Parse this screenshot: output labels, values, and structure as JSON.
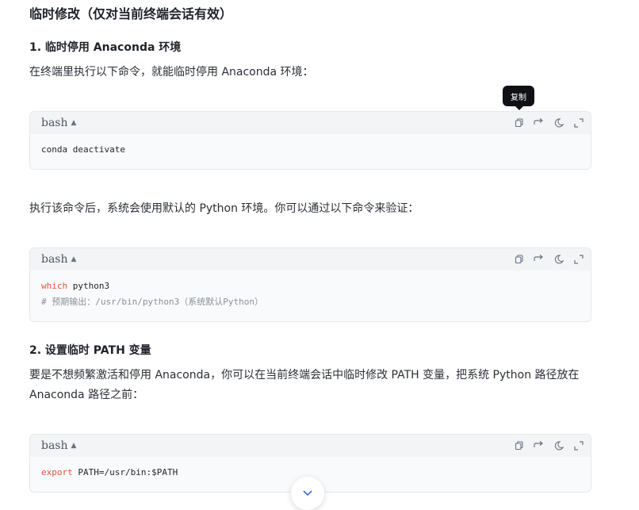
{
  "heading": "临时修改（仅对当前终端会话有效）",
  "section1": {
    "title": "1. 临时停用 Anaconda 环境",
    "para": "在终端里执行以下命令，就能临时停用 Anaconda 环境："
  },
  "tooltip": "复制",
  "code1": {
    "lang": "bash",
    "line1": "conda deactivate"
  },
  "para2": "执行该命令后，系统会使用默认的 Python 环境。你可以通过以下命令来验证：",
  "code2": {
    "lang": "bash",
    "kw": "which",
    "rest": " python3",
    "comment": "# 预期输出：/usr/bin/python3（系统默认Python）"
  },
  "section2": {
    "title": "2. 设置临时 PATH 变量",
    "para_line1": "要是不想频繁激活和停用 Anaconda，你可以在当前终端会话中临时修改 PATH 变量，把系统 Python 路径放在",
    "para_line2": "Anaconda 路径之前："
  },
  "code3": {
    "lang": "bash",
    "kw": "export",
    "rest": " PATH=/usr/bin:$PATH"
  },
  "icons": [
    "copy-icon",
    "wrap-icon",
    "theme-icon",
    "expand-icon",
    "chevron-down-icon"
  ]
}
